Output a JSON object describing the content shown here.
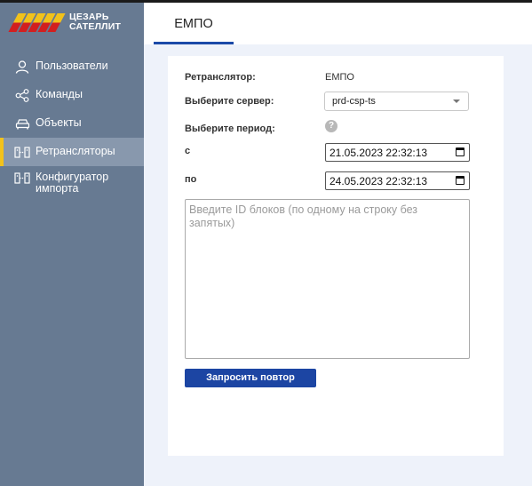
{
  "brand": {
    "line1": "ЦЕЗАРЬ",
    "line2": "САТЕЛЛИТ"
  },
  "sidebar": {
    "items": [
      {
        "label": "Пользователи",
        "icon": "user-icon"
      },
      {
        "label": "Команды",
        "icon": "share-nodes-icon"
      },
      {
        "label": "Объекты",
        "icon": "car-icon"
      },
      {
        "label": "Ретрансляторы",
        "icon": "relay-icon",
        "active": true
      },
      {
        "label": "Конфигуратор импорта",
        "icon": "relay-icon"
      }
    ]
  },
  "header": {
    "tab": "ЕМПО"
  },
  "form": {
    "relay_label": "Ретранслятор:",
    "relay_value": "ЕМПО",
    "server_label": "Выберите сервер:",
    "server_value": "prd-csp-ts",
    "period_label": "Выберите период:",
    "help_glyph": "?",
    "from_label": "с",
    "from_value": "21.05.2023 22:32:13",
    "to_label": "по",
    "to_value": "24.05.2023 22:32:13",
    "ids_placeholder": "Введите ID блоков (по одному на строку без запятых)",
    "submit_label": "Запросить повтор"
  },
  "colors": {
    "sidebar": "#677a92",
    "active_item": "#8898ad",
    "accent_yellow": "#f2c21b",
    "accent_red": "#d21f1f",
    "primary_button": "#1c45a3",
    "tab_underline": "#1b4aa8",
    "background": "#eef2fa"
  }
}
